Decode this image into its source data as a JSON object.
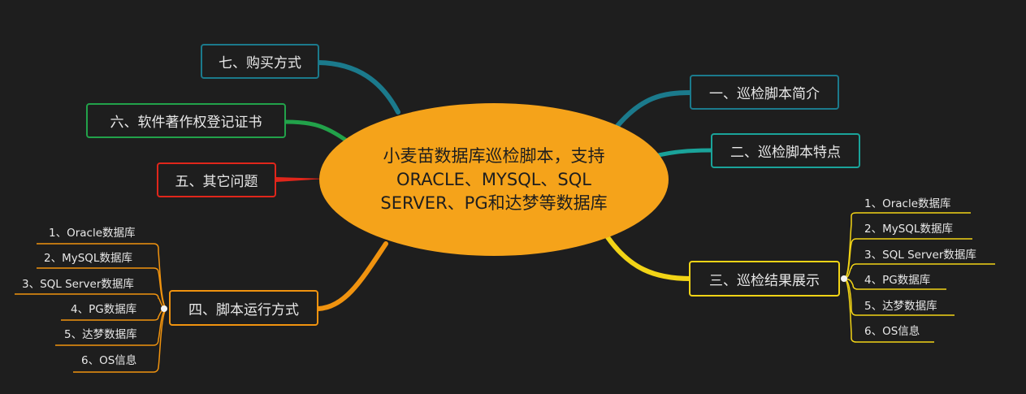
{
  "center": {
    "text": "小麦苗数据库巡检脚本，支持ORACLE、MYSQL、SQL SERVER、PG和达梦等数据库"
  },
  "colors": {
    "background": "#1e1e1e",
    "center": "#f5a31a",
    "teal": "#1b7a8c",
    "cyan": "#1aa39a",
    "green": "#22a24a",
    "red": "#e0261b",
    "orange": "#f0930f",
    "yellow": "#f2d416",
    "blue": "#2a88b8"
  },
  "topics": {
    "t1": "一、巡检脚本简介",
    "t2": "二、巡检脚本特点",
    "t3": "三、巡检结果展示",
    "t4": "四、脚本运行方式",
    "t5": "五、其它问题",
    "t6": "六、软件著作权登记证书",
    "t7": "七、购买方式"
  },
  "results_children": [
    "1、Oracle数据库",
    "2、MySQL数据库",
    "3、SQL Server数据库",
    "4、PG数据库",
    "5、达梦数据库",
    "6、OS信息"
  ],
  "run_children": [
    "1、Oracle数据库",
    "2、MySQL数据库",
    "3、SQL Server数据库",
    "4、PG数据库",
    "5、达梦数据库",
    "6、OS信息"
  ]
}
